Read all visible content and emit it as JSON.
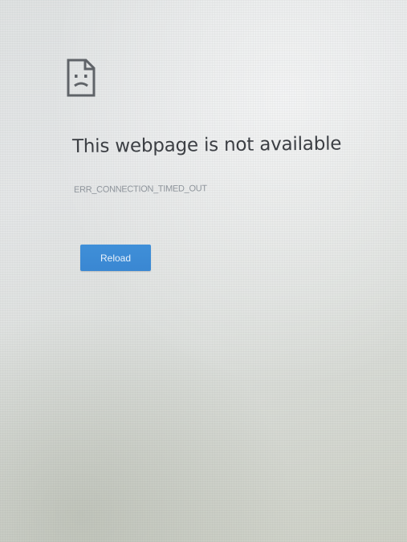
{
  "error": {
    "icon": "sad-page-icon",
    "title": "This webpage is not available",
    "code": "ERR_CONNECTION_TIMED_OUT"
  },
  "actions": {
    "reload_label": "Reload"
  },
  "colors": {
    "button": "#3a87d2",
    "title_text": "#3c3f44",
    "code_text": "#8f959c",
    "icon_stroke": "#5f6368"
  }
}
